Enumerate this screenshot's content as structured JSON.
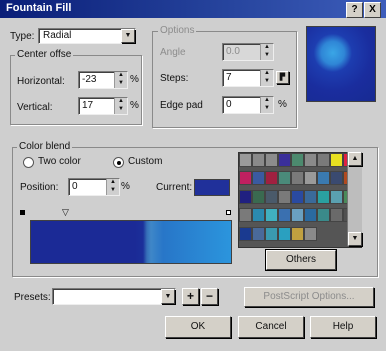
{
  "window": {
    "title": "Fountain Fill",
    "help_button": "?",
    "close_button": "X"
  },
  "type": {
    "label": "Type:",
    "value": "Radial"
  },
  "center_offset": {
    "title": "Center offse",
    "horizontal_label": "Horizontal:",
    "horizontal_value": "-23",
    "horizontal_unit": "%",
    "vertical_label": "Vertical:",
    "vertical_value": "17",
    "vertical_unit": "%"
  },
  "options": {
    "title": "Options",
    "angle_label": "Angle",
    "angle_value": "0.0",
    "steps_label": "Steps:",
    "steps_value": "7",
    "edge_pad_label": "Edge pad",
    "edge_pad_value": "0",
    "edge_pad_unit": "%"
  },
  "color_blend": {
    "title": "Color blend",
    "two_color_label": "Two color",
    "custom_label": "Custom",
    "position_label": "Position:",
    "position_value": "0",
    "position_unit": "%",
    "current_label": "Current:",
    "current_color": "#20309a",
    "others_button": "Others"
  },
  "palette_colors": [
    "#9a9a9a",
    "#8a8a8a",
    "#8c8c8c",
    "#3a2f9a",
    "#4c8a6e",
    "#8a8a8a",
    "#7a7a7a",
    "#e8e020",
    "#e02040",
    "#c02060",
    "#3a5aa0",
    "#a02040",
    "#4a8a7a",
    "#7a7a7a",
    "#9a9a9a",
    "#3a7ab0",
    "#3a4a70",
    "#b04a20",
    "#202080",
    "#3a6a50",
    "#4a5a6a",
    "#7a7a7a",
    "#2a4aa0",
    "#3a6a9a",
    "#2aa0a0",
    "#5aa0b0",
    "#4a8a5a",
    "#7a7a7a",
    "#2a8ab0",
    "#40b0c0",
    "#3a70b0",
    "#6aa0c0",
    "#2a6aa0",
    "#3a8a8a",
    "#6a6a6a",
    "#505050",
    "#1a3a90",
    "#4a6a9a",
    "#3a9ab0",
    "#2aa0c0",
    "#c0a040",
    "#8a8a8a"
  ],
  "presets": {
    "label": "Presets:",
    "value": "",
    "add": "+",
    "remove": "−"
  },
  "buttons": {
    "postscript": "PostScript Options...",
    "ok": "OK",
    "cancel": "Cancel",
    "help": "Help"
  }
}
